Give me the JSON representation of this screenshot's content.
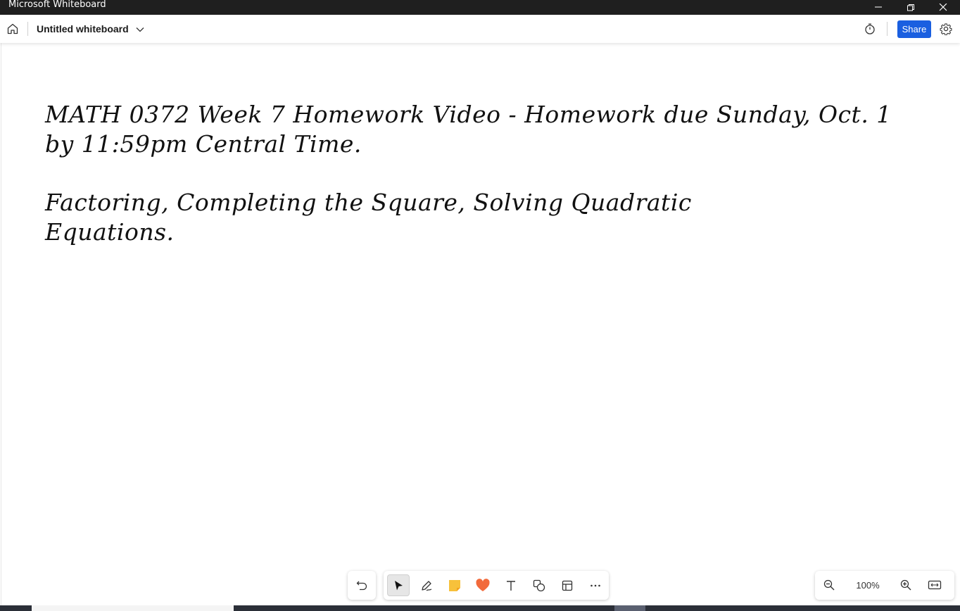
{
  "window": {
    "title": "Microsoft Whiteboard",
    "controls": [
      "minimize-icon",
      "restore-icon",
      "close-icon"
    ]
  },
  "header": {
    "board_title": "Untitled whiteboard",
    "share_label": "Share",
    "icons": [
      "home-icon",
      "chevron-down-icon",
      "timer-icon",
      "gear-icon"
    ]
  },
  "canvas": {
    "ink_line_1": "MATH 0372 Week 7 Homework Video - Homework due Sunday, Oct. 1 by 11:59pm Central Time.",
    "ink_line_2": "Factoring, Completing the Square, Solving Quadratic Equations."
  },
  "toolbar": {
    "tools": [
      "undo-icon",
      "select-icon",
      "pen-icon",
      "sticky-note-icon",
      "reaction-icon",
      "text-icon",
      "shapes-icon",
      "templates-icon",
      "more-icon"
    ],
    "active_tool": "select"
  },
  "zoom": {
    "level": "100%",
    "icons": [
      "zoom-out-icon",
      "zoom-in-icon",
      "fit-to-screen-icon"
    ]
  },
  "colors": {
    "titlebar_bg": "#1f1f1f",
    "accent": "#1a5fe0",
    "sticky_note": "#f7c13b",
    "reaction": "#f26a3b"
  }
}
